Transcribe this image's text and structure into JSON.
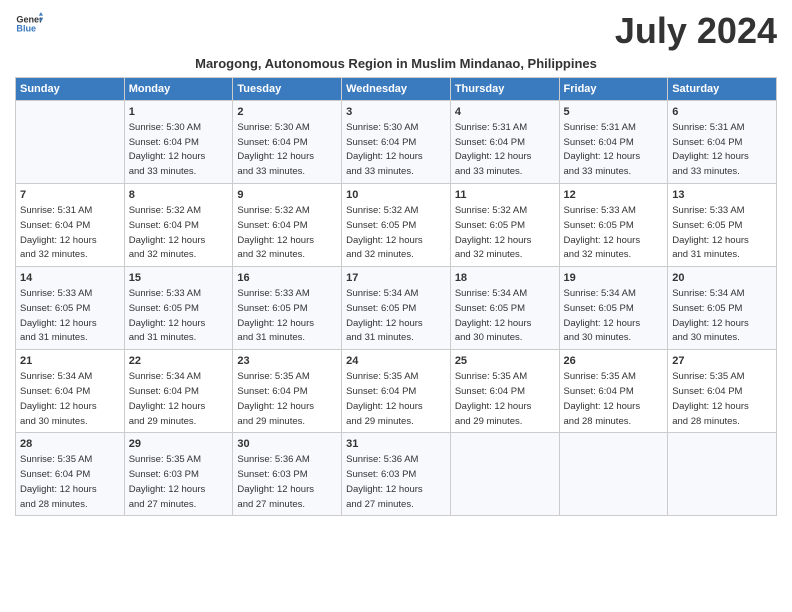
{
  "logo": {
    "line1": "General",
    "line2": "Blue"
  },
  "month_title": "July 2024",
  "subtitle": "Marogong, Autonomous Region in Muslim Mindanao, Philippines",
  "header": {
    "days": [
      "Sunday",
      "Monday",
      "Tuesday",
      "Wednesday",
      "Thursday",
      "Friday",
      "Saturday"
    ]
  },
  "weeks": [
    {
      "cells": [
        {
          "day": "",
          "num": "",
          "sunrise": "",
          "sunset": "",
          "daylight1": "",
          "daylight2": ""
        },
        {
          "day": "Monday",
          "num": "1",
          "sunrise": "Sunrise: 5:30 AM",
          "sunset": "Sunset: 6:04 PM",
          "daylight1": "Daylight: 12 hours",
          "daylight2": "and 33 minutes."
        },
        {
          "day": "Tuesday",
          "num": "2",
          "sunrise": "Sunrise: 5:30 AM",
          "sunset": "Sunset: 6:04 PM",
          "daylight1": "Daylight: 12 hours",
          "daylight2": "and 33 minutes."
        },
        {
          "day": "Wednesday",
          "num": "3",
          "sunrise": "Sunrise: 5:30 AM",
          "sunset": "Sunset: 6:04 PM",
          "daylight1": "Daylight: 12 hours",
          "daylight2": "and 33 minutes."
        },
        {
          "day": "Thursday",
          "num": "4",
          "sunrise": "Sunrise: 5:31 AM",
          "sunset": "Sunset: 6:04 PM",
          "daylight1": "Daylight: 12 hours",
          "daylight2": "and 33 minutes."
        },
        {
          "day": "Friday",
          "num": "5",
          "sunrise": "Sunrise: 5:31 AM",
          "sunset": "Sunset: 6:04 PM",
          "daylight1": "Daylight: 12 hours",
          "daylight2": "and 33 minutes."
        },
        {
          "day": "Saturday",
          "num": "6",
          "sunrise": "Sunrise: 5:31 AM",
          "sunset": "Sunset: 6:04 PM",
          "daylight1": "Daylight: 12 hours",
          "daylight2": "and 33 minutes."
        }
      ]
    },
    {
      "cells": [
        {
          "num": "7",
          "sunrise": "Sunrise: 5:31 AM",
          "sunset": "Sunset: 6:04 PM",
          "daylight1": "Daylight: 12 hours",
          "daylight2": "and 32 minutes."
        },
        {
          "num": "8",
          "sunrise": "Sunrise: 5:32 AM",
          "sunset": "Sunset: 6:04 PM",
          "daylight1": "Daylight: 12 hours",
          "daylight2": "and 32 minutes."
        },
        {
          "num": "9",
          "sunrise": "Sunrise: 5:32 AM",
          "sunset": "Sunset: 6:04 PM",
          "daylight1": "Daylight: 12 hours",
          "daylight2": "and 32 minutes."
        },
        {
          "num": "10",
          "sunrise": "Sunrise: 5:32 AM",
          "sunset": "Sunset: 6:05 PM",
          "daylight1": "Daylight: 12 hours",
          "daylight2": "and 32 minutes."
        },
        {
          "num": "11",
          "sunrise": "Sunrise: 5:32 AM",
          "sunset": "Sunset: 6:05 PM",
          "daylight1": "Daylight: 12 hours",
          "daylight2": "and 32 minutes."
        },
        {
          "num": "12",
          "sunrise": "Sunrise: 5:33 AM",
          "sunset": "Sunset: 6:05 PM",
          "daylight1": "Daylight: 12 hours",
          "daylight2": "and 32 minutes."
        },
        {
          "num": "13",
          "sunrise": "Sunrise: 5:33 AM",
          "sunset": "Sunset: 6:05 PM",
          "daylight1": "Daylight: 12 hours",
          "daylight2": "and 31 minutes."
        }
      ]
    },
    {
      "cells": [
        {
          "num": "14",
          "sunrise": "Sunrise: 5:33 AM",
          "sunset": "Sunset: 6:05 PM",
          "daylight1": "Daylight: 12 hours",
          "daylight2": "and 31 minutes."
        },
        {
          "num": "15",
          "sunrise": "Sunrise: 5:33 AM",
          "sunset": "Sunset: 6:05 PM",
          "daylight1": "Daylight: 12 hours",
          "daylight2": "and 31 minutes."
        },
        {
          "num": "16",
          "sunrise": "Sunrise: 5:33 AM",
          "sunset": "Sunset: 6:05 PM",
          "daylight1": "Daylight: 12 hours",
          "daylight2": "and 31 minutes."
        },
        {
          "num": "17",
          "sunrise": "Sunrise: 5:34 AM",
          "sunset": "Sunset: 6:05 PM",
          "daylight1": "Daylight: 12 hours",
          "daylight2": "and 31 minutes."
        },
        {
          "num": "18",
          "sunrise": "Sunrise: 5:34 AM",
          "sunset": "Sunset: 6:05 PM",
          "daylight1": "Daylight: 12 hours",
          "daylight2": "and 30 minutes."
        },
        {
          "num": "19",
          "sunrise": "Sunrise: 5:34 AM",
          "sunset": "Sunset: 6:05 PM",
          "daylight1": "Daylight: 12 hours",
          "daylight2": "and 30 minutes."
        },
        {
          "num": "20",
          "sunrise": "Sunrise: 5:34 AM",
          "sunset": "Sunset: 6:05 PM",
          "daylight1": "Daylight: 12 hours",
          "daylight2": "and 30 minutes."
        }
      ]
    },
    {
      "cells": [
        {
          "num": "21",
          "sunrise": "Sunrise: 5:34 AM",
          "sunset": "Sunset: 6:04 PM",
          "daylight1": "Daylight: 12 hours",
          "daylight2": "and 30 minutes."
        },
        {
          "num": "22",
          "sunrise": "Sunrise: 5:34 AM",
          "sunset": "Sunset: 6:04 PM",
          "daylight1": "Daylight: 12 hours",
          "daylight2": "and 29 minutes."
        },
        {
          "num": "23",
          "sunrise": "Sunrise: 5:35 AM",
          "sunset": "Sunset: 6:04 PM",
          "daylight1": "Daylight: 12 hours",
          "daylight2": "and 29 minutes."
        },
        {
          "num": "24",
          "sunrise": "Sunrise: 5:35 AM",
          "sunset": "Sunset: 6:04 PM",
          "daylight1": "Daylight: 12 hours",
          "daylight2": "and 29 minutes."
        },
        {
          "num": "25",
          "sunrise": "Sunrise: 5:35 AM",
          "sunset": "Sunset: 6:04 PM",
          "daylight1": "Daylight: 12 hours",
          "daylight2": "and 29 minutes."
        },
        {
          "num": "26",
          "sunrise": "Sunrise: 5:35 AM",
          "sunset": "Sunset: 6:04 PM",
          "daylight1": "Daylight: 12 hours",
          "daylight2": "and 28 minutes."
        },
        {
          "num": "27",
          "sunrise": "Sunrise: 5:35 AM",
          "sunset": "Sunset: 6:04 PM",
          "daylight1": "Daylight: 12 hours",
          "daylight2": "and 28 minutes."
        }
      ]
    },
    {
      "cells": [
        {
          "num": "28",
          "sunrise": "Sunrise: 5:35 AM",
          "sunset": "Sunset: 6:04 PM",
          "daylight1": "Daylight: 12 hours",
          "daylight2": "and 28 minutes."
        },
        {
          "num": "29",
          "sunrise": "Sunrise: 5:35 AM",
          "sunset": "Sunset: 6:03 PM",
          "daylight1": "Daylight: 12 hours",
          "daylight2": "and 27 minutes."
        },
        {
          "num": "30",
          "sunrise": "Sunrise: 5:36 AM",
          "sunset": "Sunset: 6:03 PM",
          "daylight1": "Daylight: 12 hours",
          "daylight2": "and 27 minutes."
        },
        {
          "num": "31",
          "sunrise": "Sunrise: 5:36 AM",
          "sunset": "Sunset: 6:03 PM",
          "daylight1": "Daylight: 12 hours",
          "daylight2": "and 27 minutes."
        },
        {
          "num": "",
          "sunrise": "",
          "sunset": "",
          "daylight1": "",
          "daylight2": ""
        },
        {
          "num": "",
          "sunrise": "",
          "sunset": "",
          "daylight1": "",
          "daylight2": ""
        },
        {
          "num": "",
          "sunrise": "",
          "sunset": "",
          "daylight1": "",
          "daylight2": ""
        }
      ]
    }
  ]
}
